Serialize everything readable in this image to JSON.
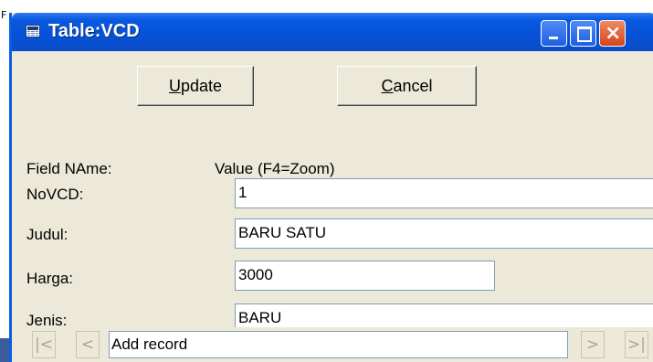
{
  "window": {
    "title": "Table:VCD",
    "controls": {
      "minimize": "minimize",
      "maximize": "maximize",
      "close": "×"
    }
  },
  "toolbar": {
    "update_pre": "",
    "update_hot": "U",
    "update_post": "pdate",
    "cancel_hot": "C",
    "cancel_post": "ancel"
  },
  "grid": {
    "field_header": "Field NAme:",
    "value_header": "Value (F4=Zoom)",
    "fields": [
      {
        "label": "NoVCD:",
        "value": "1"
      },
      {
        "label": "Judul:",
        "value": "BARU SATU"
      },
      {
        "label": "Harga:",
        "value": "3000"
      },
      {
        "label": "Jenis:",
        "value": "BARU"
      }
    ]
  },
  "navigation": {
    "first": "|<",
    "prev": "<",
    "status": "Add record",
    "next": ">",
    "last": ">|"
  },
  "background": {
    "mark": "F"
  },
  "colors": {
    "title_bar": "#0552d8",
    "face": "#ece9d8",
    "close_button": "#d6431b"
  }
}
